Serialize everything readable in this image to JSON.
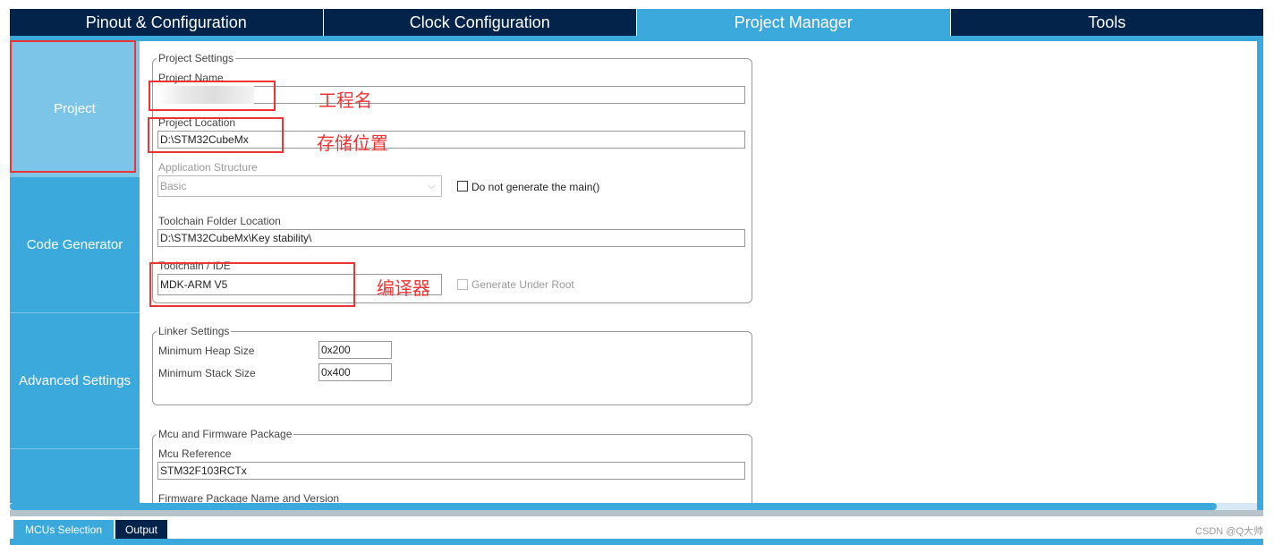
{
  "tabs": [
    {
      "label": "Pinout & Configuration"
    },
    {
      "label": "Clock Configuration"
    },
    {
      "label": "Project Manager",
      "active": true
    },
    {
      "label": "Tools"
    }
  ],
  "sidebar": {
    "items": [
      {
        "label": "Project",
        "active": true
      },
      {
        "label": "Code Generator"
      },
      {
        "label": "Advanced Settings"
      },
      {
        "label": ""
      }
    ]
  },
  "project_settings": {
    "title": "Project Settings",
    "project_name_label": "Project Name",
    "project_name_value": "",
    "project_location_label": "Project Location",
    "project_location_value": "D:\\STM32CubeMx",
    "app_structure_label": "Application Structure",
    "app_structure_value": "Basic",
    "do_not_generate_main": "Do not generate the main()",
    "toolchain_folder_label": "Toolchain Folder Location",
    "toolchain_folder_value": "D:\\STM32CubeMx\\Key stability\\",
    "toolchain_ide_label": "Toolchain / IDE",
    "toolchain_ide_value": "MDK-ARM V5",
    "generate_under_root": "Generate Under Root"
  },
  "linker_settings": {
    "title": "Linker Settings",
    "heap_label": "Minimum Heap Size",
    "heap_value": "0x200",
    "stack_label": "Minimum Stack Size",
    "stack_value": "0x400"
  },
  "mcu_firmware": {
    "title": "Mcu and Firmware Package",
    "mcu_ref_label": "Mcu Reference",
    "mcu_ref_value": "STM32F103RCTx",
    "firmware_label": "Firmware Package Name and Version"
  },
  "annotations": {
    "name": "工程名",
    "location": "存储位置",
    "compiler": "编译器"
  },
  "bottom_tabs": [
    {
      "label": "MCUs Selection"
    },
    {
      "label": "Output"
    }
  ],
  "watermark": "CSDN @Q大帅",
  "colors": {
    "navy": "#03234b",
    "accent": "#3ca9dc",
    "annotation": "#ee3333"
  }
}
